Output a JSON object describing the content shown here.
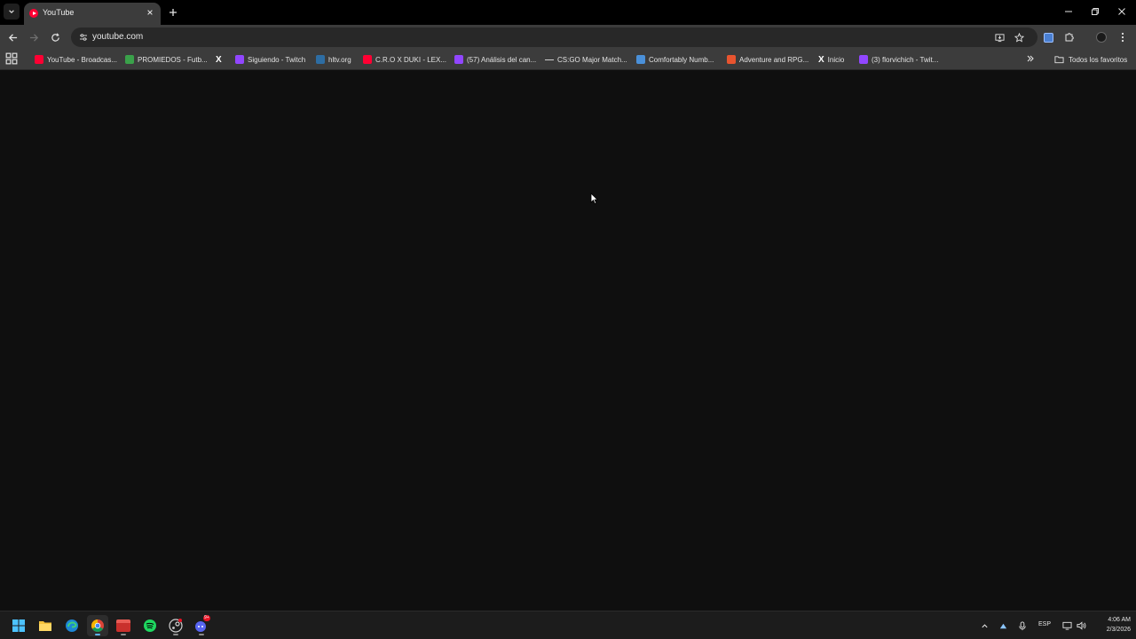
{
  "browser": {
    "tab_title": "YouTube",
    "url": "youtube.com",
    "accent_color": "#ff0033"
  },
  "bookmarks": [
    {
      "label": "YouTube - Broadcas...",
      "icon": "youtube-icon",
      "color": "#ff0033"
    },
    {
      "label": "PROMIEDOS - Futb...",
      "icon": "promiedos-icon",
      "color": "#3aa14a"
    },
    {
      "label": "",
      "icon": "x-icon",
      "color": "#ffffff"
    },
    {
      "label": "Siguiendo - Twitch",
      "icon": "twitch-icon",
      "color": "#9146ff"
    },
    {
      "label": "hltv.org",
      "icon": "hltv-icon",
      "color": "#2d6da3"
    },
    {
      "label": "C.R.O X DUKI - LEX...",
      "icon": "youtube-icon",
      "color": "#ff0033"
    },
    {
      "label": "(57) Análisis del can...",
      "icon": "twitch-icon",
      "color": "#9146ff"
    },
    {
      "label": "CS:GO Major Match...",
      "icon": "dash-icon",
      "color": "#cfcfcf"
    },
    {
      "label": "Comfortably Numb...",
      "icon": "doc-icon",
      "color": "#4a90d9"
    },
    {
      "label": "Adventure and RPG...",
      "icon": "game-icon",
      "color": "#e8542f"
    },
    {
      "label": "Inicio",
      "icon": "x-icon",
      "color": "#ffffff"
    },
    {
      "label": "(3) florvichich - Twit...",
      "icon": "twitch-icon",
      "color": "#9146ff"
    }
  ],
  "bookmarks_folder": "Todos los favoritos",
  "taskbar": {
    "apps": [
      "windows-start-icon",
      "file-explorer-icon",
      "edge-icon",
      "chrome-icon",
      "app-icon",
      "spotify-icon",
      "steam-icon",
      "discord-icon"
    ],
    "discord_badge": "9+",
    "language": "ESP",
    "time": "4:06 AM",
    "date": "2/3/2026"
  }
}
